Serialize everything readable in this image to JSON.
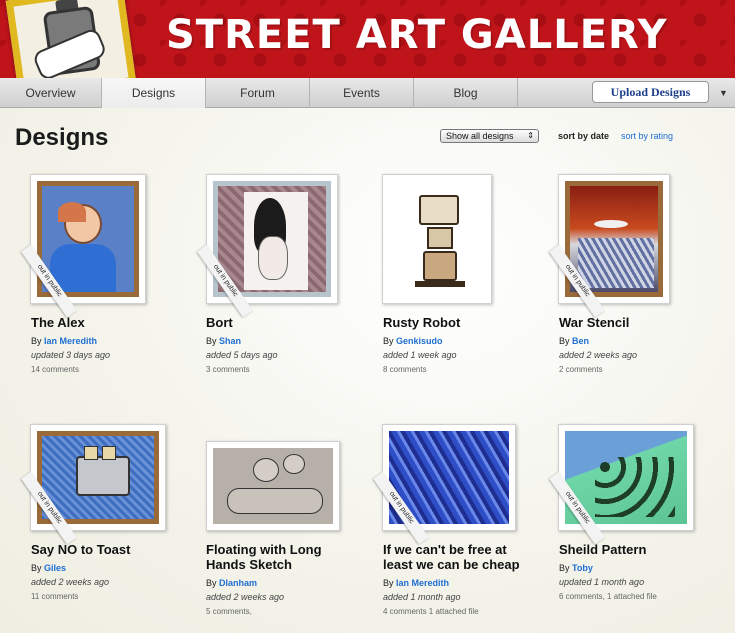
{
  "header": {
    "title": "STREET ART GALLERY"
  },
  "nav": {
    "items": [
      {
        "label": "Overview"
      },
      {
        "label": "Designs"
      },
      {
        "label": "Forum"
      },
      {
        "label": "Events"
      },
      {
        "label": "Blog"
      }
    ],
    "upload_label": "Upload Designs",
    "dropdown_icon": "chevron-down-icon"
  },
  "page": {
    "title": "Designs",
    "filter": "Show all designs",
    "sort_date": "sort by date",
    "sort_rating": "sort by rating"
  },
  "ribbon_text": "out in public",
  "designs": [
    {
      "title": "The Alex",
      "by": "By",
      "author": "Ian Meredith",
      "date": "updated 3 days ago",
      "comments": "14 comments"
    },
    {
      "title": "Bort",
      "by": "By",
      "author": "Shan",
      "date": "added 5 days ago",
      "comments": "3 comments"
    },
    {
      "title": "Rusty Robot",
      "by": "By",
      "author": "Genkisudo",
      "date": "added 1 week ago",
      "comments": "8 comments"
    },
    {
      "title": "War Stencil",
      "by": "By",
      "author": "Ben",
      "date": "added 2 weeks ago",
      "comments": "2 comments"
    },
    {
      "title": "Say NO to Toast",
      "by": "By",
      "author": "Giles",
      "date": "added 2 weeks ago",
      "comments": "11 comments"
    },
    {
      "title": "Floating with Long Hands Sketch",
      "by": "By",
      "author": "Dlanham",
      "date": "added 2 weeks ago",
      "comments": "5 comments,"
    },
    {
      "title": "If we can't be free at least we can be cheap",
      "by": "By",
      "author": "Ian Meredith",
      "date": "added 1 month ago",
      "comments": "4 comments  1 attached file"
    },
    {
      "title": "Sheild Pattern",
      "by": "By",
      "author": "Toby",
      "date": "updated 1 month ago",
      "comments": "6 comments,  1 attached file"
    }
  ]
}
